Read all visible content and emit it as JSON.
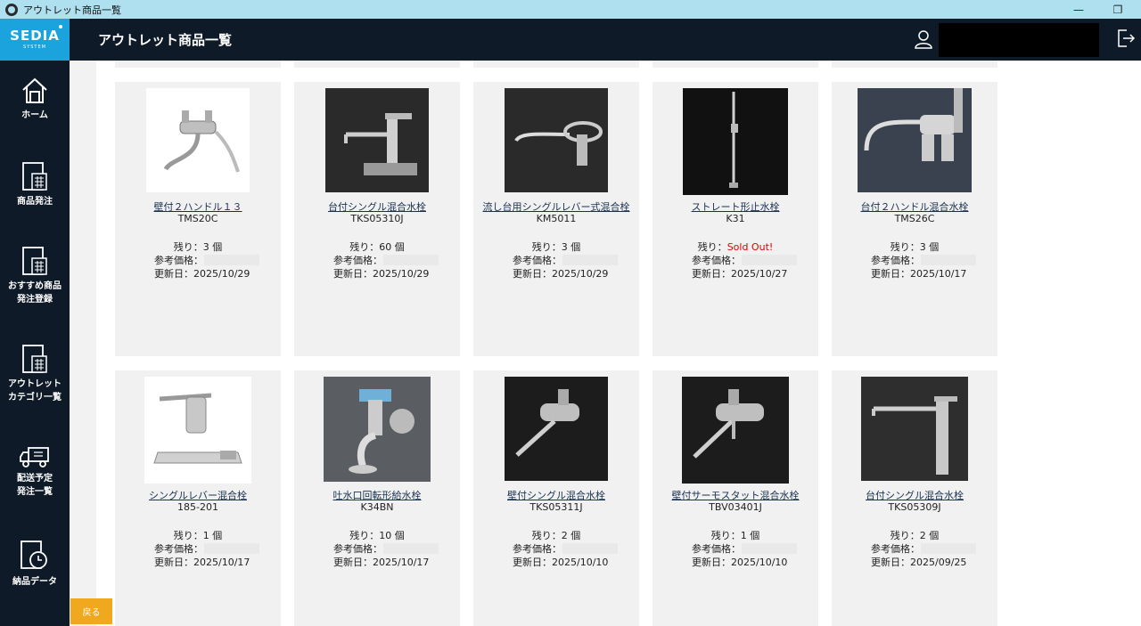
{
  "window": {
    "title": "アウトレット商品一覧",
    "minimize": "—",
    "restore": "❐"
  },
  "header": {
    "logo_brand": "SEDIA",
    "logo_sub": "SYSTEM",
    "page_title": "アウトレット商品一覧"
  },
  "sidebar": {
    "items": [
      {
        "label": "ホーム",
        "icon": "home-icon"
      },
      {
        "label": "商品発注",
        "icon": "order-icon"
      },
      {
        "label": "おすすめ商品\n発注登録",
        "icon": "recommend-order-icon"
      },
      {
        "label": "アウトレット\nカテゴリ一覧",
        "icon": "outlet-category-icon"
      },
      {
        "label": "配送予定\n発注一覧",
        "icon": "delivery-truck-icon"
      },
      {
        "label": "納品データ",
        "icon": "delivery-data-icon"
      }
    ]
  },
  "labels": {
    "stock_prefix": "残り：",
    "price_prefix": "参考価格：",
    "date_prefix": "更新日："
  },
  "products": [
    {
      "name": "壁付２ハンドル１３",
      "code": "TMS20C",
      "stock": "3 個",
      "sold_out": false,
      "date": "2025/10/29",
      "image": "light"
    },
    {
      "name": "台付シングル混合水栓",
      "code": "TKS05310J",
      "stock": "60 個",
      "sold_out": false,
      "date": "2025/10/29",
      "image": "dark"
    },
    {
      "name": "流し台用シングルレバー式混合栓",
      "code": "KM5011",
      "stock": "3 個",
      "sold_out": false,
      "date": "2025/10/29",
      "image": "dark"
    },
    {
      "name": "ストレート形止水栓",
      "code": "K31",
      "stock": "Sold Out!",
      "sold_out": true,
      "date": "2025/10/27",
      "image": "dark"
    },
    {
      "name": "台付２ハンドル混合水栓",
      "code": "TMS26C",
      "stock": "3 個",
      "sold_out": false,
      "date": "2025/10/17",
      "image": "dark"
    },
    {
      "name": "シングルレバー混合栓",
      "code": "185-201",
      "stock": "1 個",
      "sold_out": false,
      "date": "2025/10/17",
      "image": "light"
    },
    {
      "name": "吐水口回転形給水栓",
      "code": "K34BN",
      "stock": "10 個",
      "sold_out": false,
      "date": "2025/10/17",
      "image": "dark"
    },
    {
      "name": "壁付シングル混合水栓",
      "code": "TKS05311J",
      "stock": "2 個",
      "sold_out": false,
      "date": "2025/10/10",
      "image": "dark"
    },
    {
      "name": "壁付サーモスタット混合水栓",
      "code": "TBV03401J",
      "stock": "1 個",
      "sold_out": false,
      "date": "2025/10/10",
      "image": "dark"
    },
    {
      "name": "台付シングル混合水栓",
      "code": "TKS05309J",
      "stock": "2 個",
      "sold_out": false,
      "date": "2025/09/25",
      "image": "dark"
    }
  ],
  "footer": {
    "back_label": "戻る"
  },
  "colors": {
    "header_bg": "#0e1a28",
    "logo_bg": "#1aa3dc",
    "sold_out": "#e00000",
    "back_button": "#f0a81e",
    "card_bg": "#f1f1f1"
  }
}
